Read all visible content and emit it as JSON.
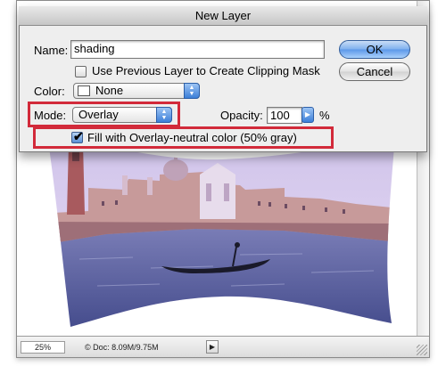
{
  "dialog": {
    "title": "New Layer",
    "name_label": "Name:",
    "name_value": "shading",
    "clipping_mask_label": "Use Previous Layer to Create Clipping Mask",
    "clipping_mask_checked": false,
    "color_label": "Color:",
    "color_value": "None",
    "mode_label": "Mode:",
    "mode_value": "Overlay",
    "opacity_label": "Opacity:",
    "opacity_value": "100",
    "opacity_unit": "%",
    "fill_neutral_label": "Fill with Overlay-neutral color (50% gray)",
    "fill_neutral_checked": true,
    "ok_label": "OK",
    "cancel_label": "Cancel"
  },
  "document": {
    "zoom": "25%",
    "doc_info": "© Doc: 8.09M/9.75M"
  },
  "colors": {
    "highlight": "#d22a3a",
    "accent_blue": "#3c7fd8",
    "dialog_bg": "#eeeeee"
  },
  "icons": {
    "checkmark": "checkmark-icon",
    "popup_arrows": "up-down-arrows-icon",
    "status_menu": "triangle-right-icon"
  }
}
